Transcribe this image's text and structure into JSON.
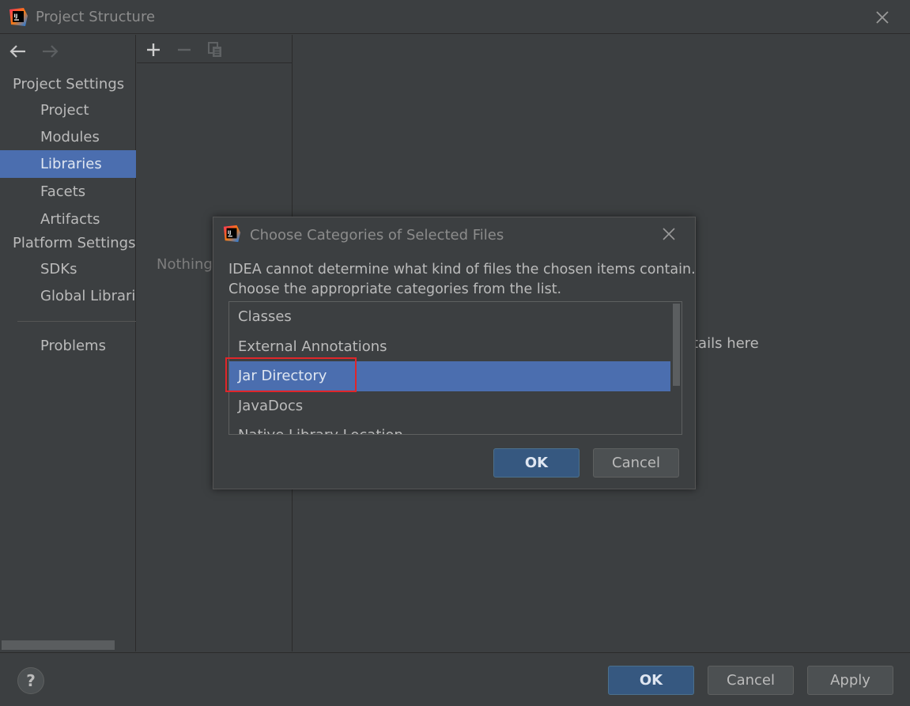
{
  "window": {
    "title": "Project Structure",
    "close_icon": "close-icon",
    "logo_icon": "intellij-logo-icon"
  },
  "sidebar": {
    "back_icon": "arrow-left-icon",
    "forward_icon": "arrow-right-icon",
    "project_settings_header": "Project Settings",
    "project_items": [
      {
        "label": "Project"
      },
      {
        "label": "Modules"
      },
      {
        "label": "Libraries",
        "selected": true
      },
      {
        "label": "Facets"
      },
      {
        "label": "Artifacts"
      }
    ],
    "platform_settings_header": "Platform Settings",
    "platform_items": [
      {
        "label": "SDKs"
      },
      {
        "label": "Global Librarie"
      }
    ],
    "problems_label": "Problems"
  },
  "list_panel": {
    "toolbar_icons": [
      "plus-icon",
      "minus-icon",
      "copy-icon"
    ],
    "empty_text": "Nothing"
  },
  "details": {
    "text": "tails here"
  },
  "footer": {
    "help_label": "?",
    "ok_label": "OK",
    "cancel_label": "Cancel",
    "apply_label": "Apply"
  },
  "dialog": {
    "title": "Choose Categories of Selected Files",
    "message_line1": "IDEA cannot determine what kind of files the chosen items contain.",
    "message_line2": "Choose the appropriate categories from the list.",
    "items": [
      {
        "label": "Classes"
      },
      {
        "label": "External Annotations"
      },
      {
        "label": "Jar Directory",
        "selected": true
      },
      {
        "label": "JavaDocs"
      },
      {
        "label": "Native Library Location"
      }
    ],
    "ok_label": "OK",
    "cancel_label": "Cancel"
  },
  "colors": {
    "background": "#3c3f41",
    "selection": "#4b6eaf",
    "primary_button": "#365880",
    "highlight_box": "#e0262a"
  }
}
